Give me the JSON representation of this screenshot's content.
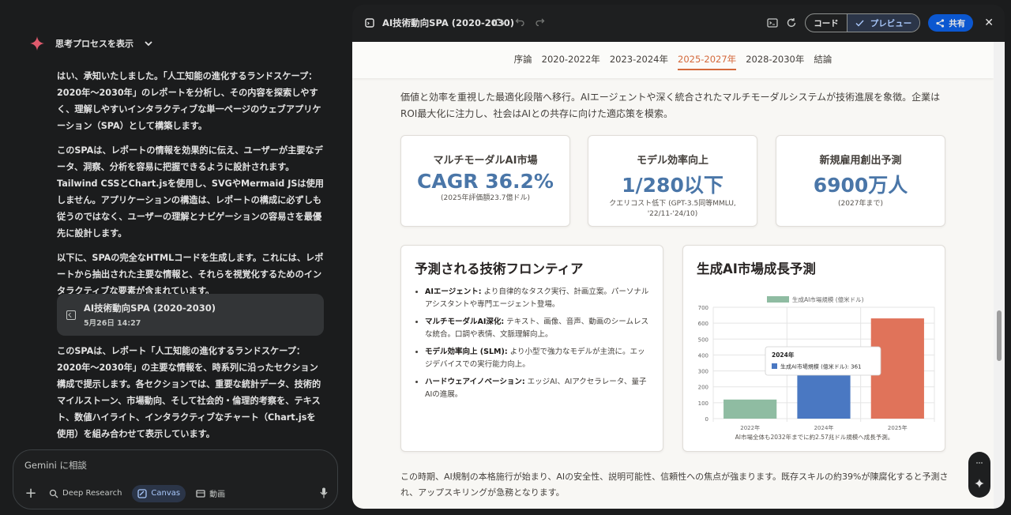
{
  "chat": {
    "think_label": "思考プロセスを表示",
    "paragraphs": [
      "はい、承知いたしました。「人工知能の進化するランドスケープ：2020年〜2030年」のレポートを分析し、その内容を探索しやすく、理解しやすいインタラクティブな単一ページのウェブアプリケーション（SPA）として構築します。",
      "このSPAは、レポートの情報を効果的に伝え、ユーザーが主要なデータ、洞察、分析を容易に把握できるように設計されます。Tailwind CSSとChart.jsを使用し、SVGやMermaid JSは使用しません。アプリケーションの構造は、レポートの構成に必ずしも従うのではなく、ユーザーの理解とナビゲーションの容易さを最優先に設計します。",
      "以下に、SPAの完全なHTMLコードを生成します。これには、レポートから抽出された主要な情報と、それらを視覚化するためのインタラクティブな要素が含まれています。"
    ],
    "artifact": {
      "title": "AI技術動向SPA (2020-2030)",
      "date": "5月26日 14:27"
    },
    "after": "このSPAは、レポート「人工知能の進化するランドスケープ：2020年〜2030年」の主要な情報を、時系列に沿ったセクション構成で提示します。各セクションでは、重要な統計データ、技術的マイルストーン、市場動向、そして社会的・倫理的考察を、テキスト、数値ハイライト、インタラクティブなチャート（Chart.jsを使用）を組み合わせて表示しています。"
  },
  "composer": {
    "placeholder": "Gemini に相談",
    "tools": [
      "Deep Research",
      "Canvas",
      "動画"
    ]
  },
  "canvas": {
    "title": "AI技術動向SPA (2020-2030)",
    "code_label": "コード",
    "preview_label": "プレビュー",
    "share_label": "共有"
  },
  "page": {
    "nav": [
      "序論",
      "2020-2022年",
      "2023-2024年",
      "2025-2027年",
      "2028-2030年",
      "結論"
    ],
    "active_nav": "2025-2027年",
    "intro": "価値と効率を重視した最適化段階へ移行。AIエージェントや深く統合されたマルチモーダルシステムが技術進展を象徴。企業はROI最大化に注力し、社会はAIとの共存に向けた適応策を模索。",
    "stats": [
      {
        "title": "マルチモーダルAI市場",
        "value": "CAGR 36.2%",
        "note": "(2025年評価額23.7億ドル)"
      },
      {
        "title": "モデル効率向上",
        "value": "1/280以下",
        "note": "クエリコスト低下 (GPT-3.5同等MMLU, '22/11-'24/10)"
      },
      {
        "title": "新規雇用創出予測",
        "value": "6900万人",
        "note": "(2027年まで)"
      }
    ],
    "frontier": {
      "title": "予測される技術フロンティア",
      "items": [
        {
          "head": "AIエージェント:",
          "text": "より自律的なタスク実行、計画立案。パーソナルアシスタントや専門エージェント登場。"
        },
        {
          "head": "マルチモーダルAI深化:",
          "text": "テキスト、画像、音声、動画のシームレスな統合。口調や表情、文脈理解向上。"
        },
        {
          "head": "モデル効率向上 (SLM):",
          "text": "より小型で強力なモデルが主流に。エッジデバイスでの実行能力向上。"
        },
        {
          "head": "ハードウェアイノベーション:",
          "text": "エッジAI、AIアクセラレータ、量子AIの進展。"
        }
      ]
    },
    "market_title": "生成AI市場成長予測",
    "footer": "この時期、AI規制の本格施行が始まり、AIの安全性、説明可能性、信頼性への焦点が強まります。既存スキルの約39%が陳腐化すると予測され、アップスキリングが急務となります。"
  },
  "chart_data": {
    "type": "bar",
    "categories": [
      "2022年",
      "2024年",
      "2025年"
    ],
    "series": [
      {
        "name": "生成AI市場規模 (億米ドル)",
        "values": [
          120,
          361,
          630
        ]
      }
    ],
    "colors": [
      "#8fbca2",
      "#4a78c2",
      "#e0735a"
    ],
    "ylim": [
      0,
      700
    ],
    "yticks": [
      0,
      100,
      200,
      300,
      400,
      500,
      600,
      700
    ],
    "legend": "top",
    "tooltip": {
      "title": "2024年",
      "text": "生成AI市場規模 (億米ドル): 361"
    },
    "caption": "AI市場全体も2032年までに約2.57兆ドル規模へ成長予測。"
  },
  "colors": {
    "accent": "#d4693b",
    "stat_value": "#4a76a8",
    "share": "#0b57d0"
  }
}
